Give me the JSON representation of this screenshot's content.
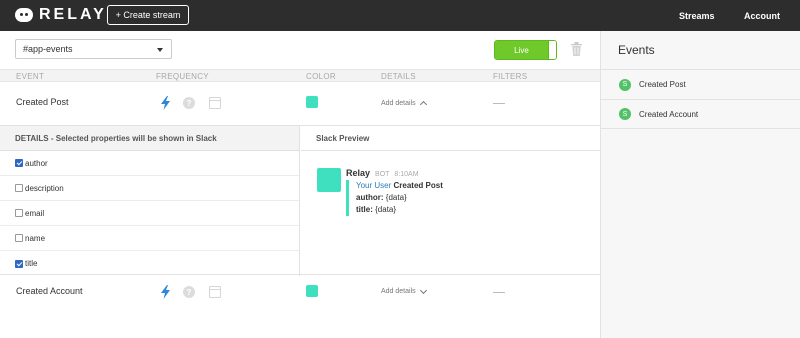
{
  "app": {
    "brand": "RELAY",
    "create_button": "+ Create stream"
  },
  "nav": {
    "streams": "Streams",
    "account": "Account"
  },
  "toolbar": {
    "channel": "#app-events",
    "live_label": "Live"
  },
  "table": {
    "headers": {
      "event": "EVENT",
      "frequency": "FREQUENCY",
      "color": "COLOR",
      "details": "DETAILS",
      "filters": "FILTERS"
    },
    "rows": [
      {
        "name": "Created Post",
        "details_label": "Add details",
        "details_expanded": true,
        "color": "#3ee0c0",
        "frequency_selected": "instant"
      },
      {
        "name": "Created Account",
        "details_label": "Add details",
        "details_expanded": false,
        "color": "#3ee0c0",
        "frequency_selected": "instant"
      }
    ]
  },
  "details_panel": {
    "header": "DETAILS - Selected properties will be shown in Slack",
    "properties": [
      {
        "label": "author",
        "checked": true
      },
      {
        "label": "description",
        "checked": false
      },
      {
        "label": "email",
        "checked": false
      },
      {
        "label": "name",
        "checked": false
      },
      {
        "label": "title",
        "checked": true
      }
    ]
  },
  "slack_preview": {
    "header": "Slack Preview",
    "bot_name": "Relay",
    "bot_tag": "BOT",
    "time": "8:10AM",
    "user_text": "Your User",
    "event_text": "Created Post",
    "fields": [
      {
        "key": "author:",
        "value": "{data}"
      },
      {
        "key": "title:",
        "value": "{data}"
      }
    ]
  },
  "sidebar": {
    "title": "Events",
    "items": [
      {
        "badge": "S",
        "label": "Created Post"
      },
      {
        "badge": "S",
        "label": "Created Account"
      }
    ]
  },
  "colors": {
    "accent": "#3ee0c0",
    "live_green": "#6fc92b",
    "bolt_blue": "#2d87d8",
    "badge_green": "#52c167"
  }
}
